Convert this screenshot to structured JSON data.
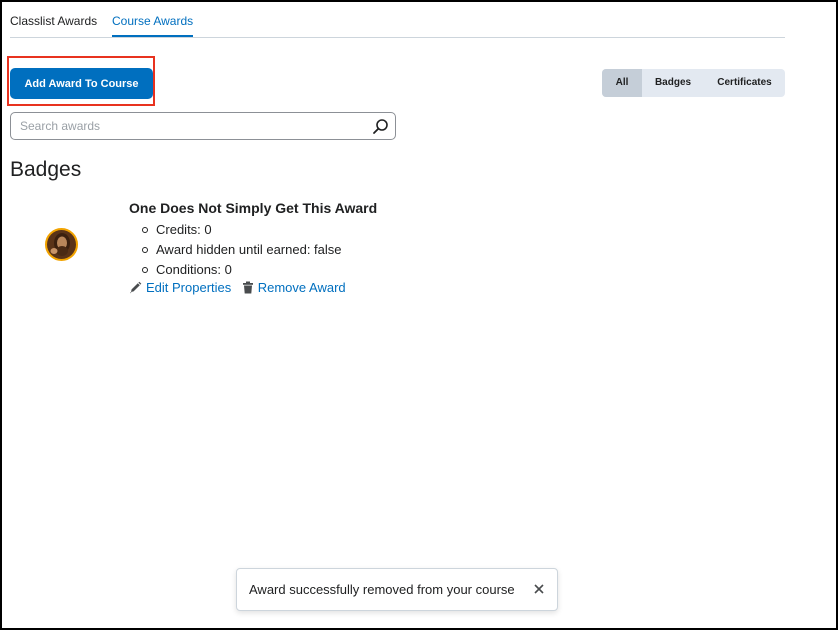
{
  "tabs": [
    {
      "label": "Classlist Awards",
      "active": false
    },
    {
      "label": "Course Awards",
      "active": true
    }
  ],
  "toolbar": {
    "add_award_label": "Add Award To Course"
  },
  "filters": {
    "options": [
      "All",
      "Badges",
      "Certificates"
    ],
    "selected": "All"
  },
  "search": {
    "placeholder": "Search awards",
    "value": ""
  },
  "section": {
    "title": "Badges"
  },
  "award": {
    "title": "One Does Not Simply Get This Award",
    "details": [
      "Credits: 0",
      "Award hidden until earned: false",
      "Conditions: 0"
    ],
    "edit_label": "Edit Properties",
    "remove_label": "Remove Award",
    "icon": "badge-avatar-icon"
  },
  "toast": {
    "message": "Award successfully removed from your course"
  },
  "colors": {
    "accent": "#006fbf",
    "highlight": "#e8321f",
    "filter_bg": "#e3e9f1",
    "filter_selected": "#c5ced8"
  }
}
